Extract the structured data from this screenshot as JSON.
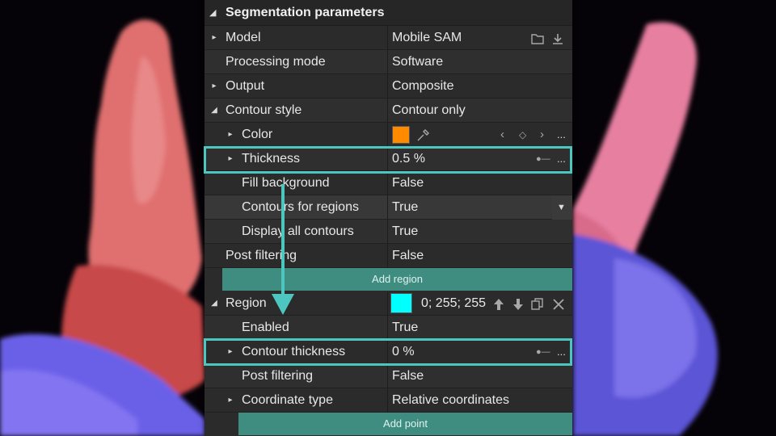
{
  "panel": {
    "title": "Segmentation parameters",
    "rows": {
      "model": {
        "label": "Model",
        "value": "Mobile SAM"
      },
      "processing_mode": {
        "label": "Processing mode",
        "value": "Software"
      },
      "output": {
        "label": "Output",
        "value": "Composite"
      },
      "contour_style": {
        "label": "Contour style",
        "value": "Contour only"
      },
      "color": {
        "label": "Color",
        "swatch": "#ff8a00"
      },
      "thickness": {
        "label": "Thickness",
        "value": "0.5 %"
      },
      "fill_background": {
        "label": "Fill background",
        "value": "False"
      },
      "contours_for_regions": {
        "label": "Contours for regions",
        "value": "True"
      },
      "display_all_contours": {
        "label": "Display all contours",
        "value": "True"
      },
      "post_filtering": {
        "label": "Post filtering",
        "value": "False"
      }
    },
    "add_region_label": "Add region",
    "region": {
      "label": "Region",
      "swatch": "#00ffff",
      "color_value": "0; 255; 255",
      "enabled": {
        "label": "Enabled",
        "value": "True"
      },
      "contour_thickness": {
        "label": "Contour thickness",
        "value": "0 %"
      },
      "post_filtering": {
        "label": "Post filtering",
        "value": "False"
      },
      "coordinate_type": {
        "label": "Coordinate type",
        "value": "Relative coordinates"
      }
    },
    "add_point_label": "Add point",
    "more_label": "..."
  },
  "colors": {
    "highlight": "#4ec6c0",
    "button": "#3f8c80",
    "panel": "#2b2b2b"
  },
  "icons": [
    "caret-down-icon",
    "caret-right-icon",
    "folder-icon",
    "download-icon",
    "eyedropper-icon",
    "chevron-left-icon",
    "diamond-icon",
    "chevron-right-icon",
    "slider-icon",
    "dropdown-arrow-icon",
    "arrow-up-icon",
    "arrow-down-icon",
    "copy-icon",
    "close-icon"
  ]
}
